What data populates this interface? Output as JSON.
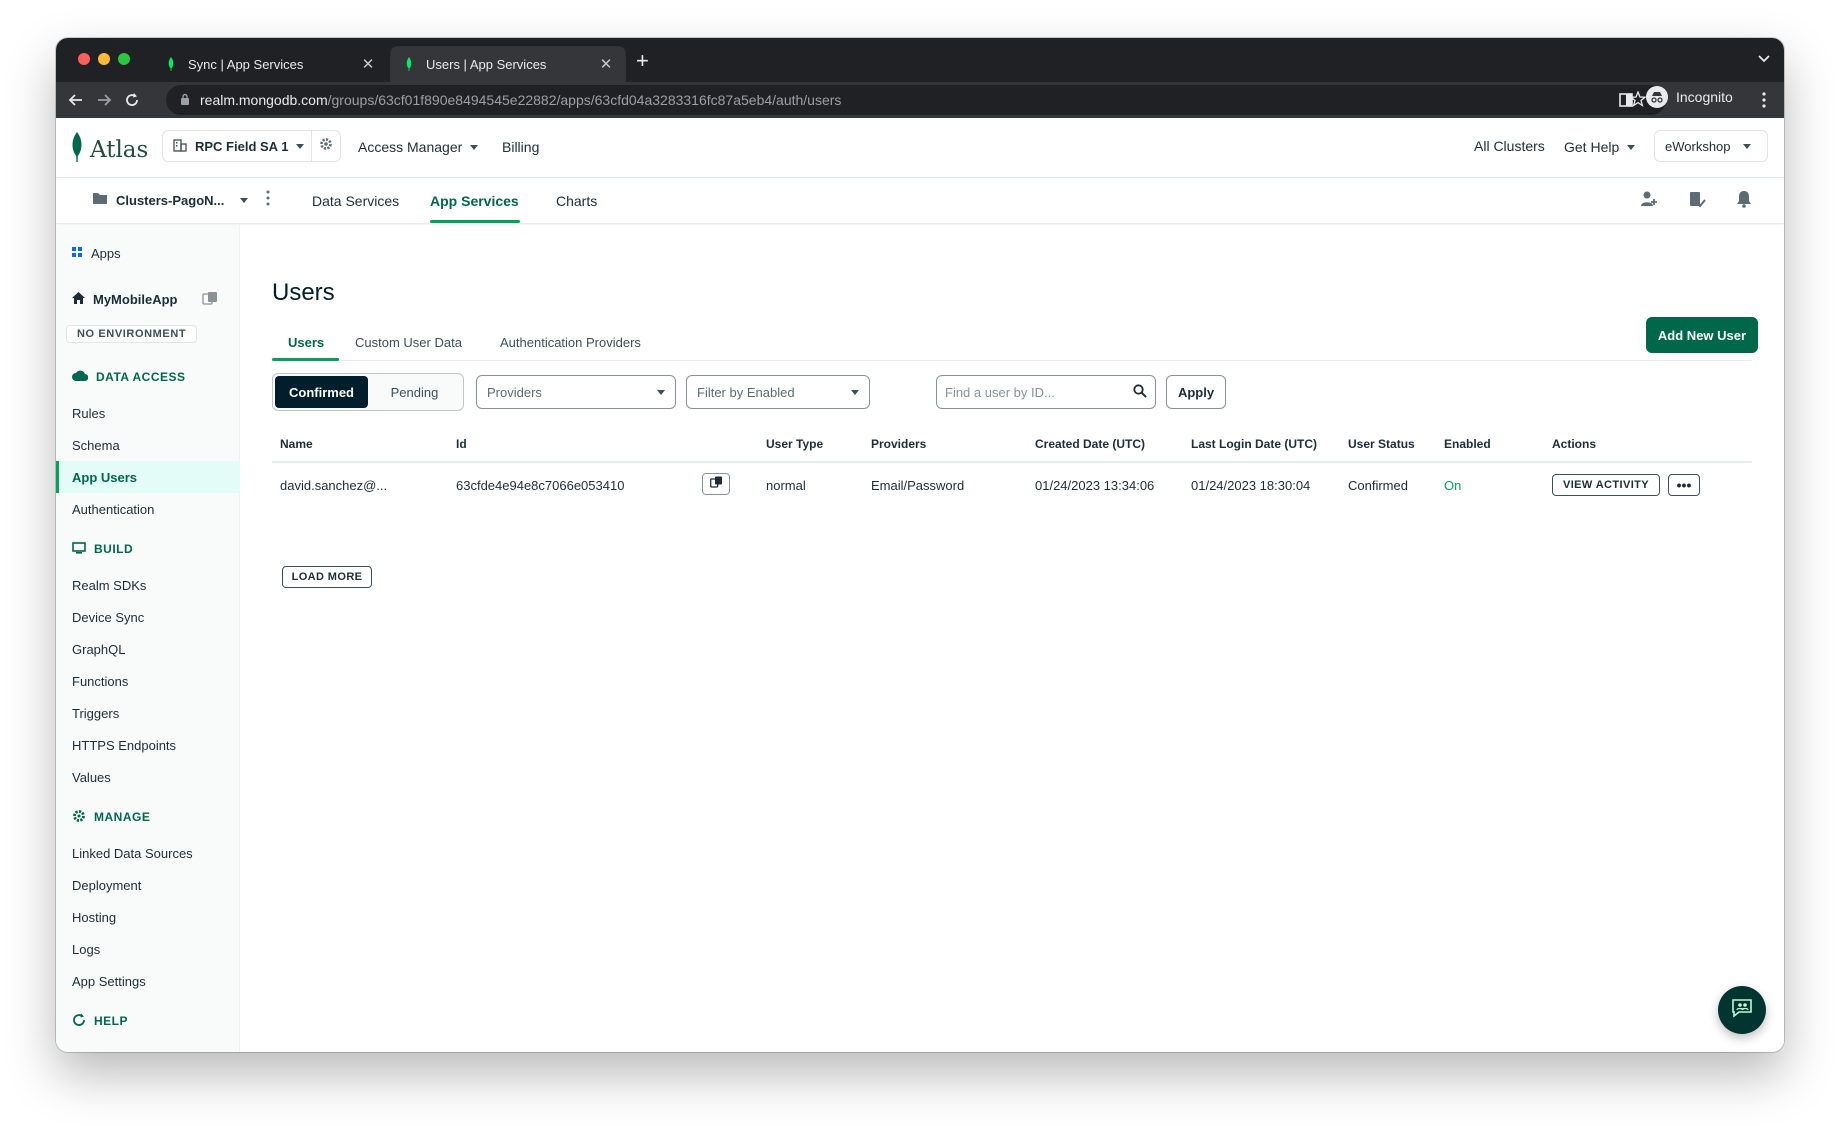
{
  "browser": {
    "tabs": [
      {
        "title": "Sync | App Services",
        "active": false
      },
      {
        "title": "Users | App Services",
        "active": true
      }
    ],
    "url_host": "realm.mongodb.com",
    "url_path": "/groups/63cf01f890e8494545e22882/apps/63cfd04a3283316fc87a5eb4/auth/users",
    "profile_label": "Incognito"
  },
  "topnav": {
    "logo": "Atlas",
    "org": "RPC Field SA 1",
    "access_manager": "Access Manager",
    "billing": "Billing",
    "all_clusters": "All Clusters",
    "get_help": "Get Help",
    "account": "eWorkshop"
  },
  "projectnav": {
    "project": "Clusters-PagoN...",
    "links": [
      "Data Services",
      "App Services",
      "Charts"
    ],
    "active": "App Services"
  },
  "sidebar": {
    "apps": "Apps",
    "app_name": "MyMobileApp",
    "environment": "NO ENVIRONMENT",
    "data_access": {
      "title": "DATA ACCESS",
      "items": [
        "Rules",
        "Schema",
        "App Users",
        "Authentication"
      ]
    },
    "build": {
      "title": "BUILD",
      "items": [
        "Realm SDKs",
        "Device Sync",
        "GraphQL",
        "Functions",
        "Triggers",
        "HTTPS Endpoints",
        "Values"
      ]
    },
    "manage": {
      "title": "MANAGE",
      "items": [
        "Linked Data Sources",
        "Deployment",
        "Hosting",
        "Logs",
        "App Settings"
      ]
    },
    "help": {
      "title": "HELP"
    },
    "active_item": "App Users"
  },
  "main": {
    "title": "Users",
    "tabs": [
      "Users",
      "Custom User Data",
      "Authentication Providers"
    ],
    "add_user_button": "Add New User",
    "segment": [
      "Confirmed",
      "Pending"
    ],
    "providers_placeholder": "Providers",
    "enabled_placeholder": "Filter by Enabled",
    "search_placeholder": "Find a user by ID...",
    "apply": "Apply",
    "table": {
      "headers": [
        "Name",
        "Id",
        "User Type",
        "Providers",
        "Created Date (UTC)",
        "Last Login Date (UTC)",
        "User Status",
        "Enabled",
        "Actions"
      ],
      "rows": [
        {
          "name": "david.sanchez@...",
          "id": "63cfde4e94e8c7066e053410",
          "user_type": "normal",
          "providers": "Email/Password",
          "created": "01/24/2023 13:34:06",
          "last_login": "01/24/2023 18:30:04",
          "status": "Confirmed",
          "enabled": "On",
          "view_activity": "VIEW ACTIVITY",
          "more": "•••"
        }
      ]
    },
    "load_more": "LOAD MORE"
  },
  "colors": {
    "brand_green": "#00684a",
    "accent_green": "#00a35c",
    "enabled_green": "#00a35c",
    "dark": "#001e2b"
  }
}
